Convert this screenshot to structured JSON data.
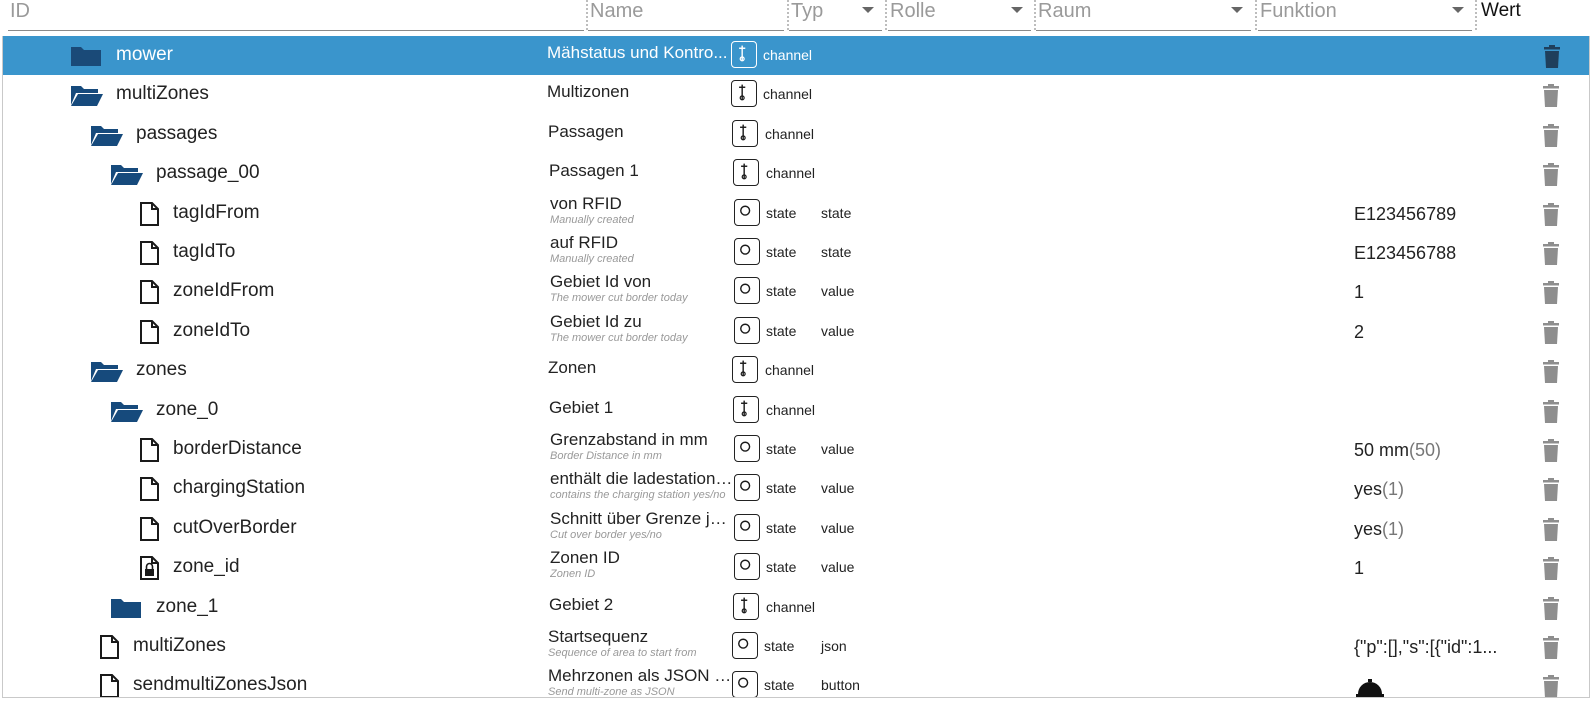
{
  "header": {
    "id_placeholder": "ID",
    "name_placeholder": "Name",
    "type_label": "Typ",
    "role_label": "Rolle",
    "room_label": "Raum",
    "function_label": "Funktion",
    "value_label": "Wert"
  },
  "rows": [
    {
      "id": "mower",
      "name": "Mähstatus und Kontro...",
      "desc": "",
      "type": "channel",
      "role": "",
      "value": "",
      "value_num": "",
      "icon": "folder-closed-icon",
      "selected": true
    },
    {
      "id": "multiZones",
      "name": "Multizonen",
      "desc": "",
      "type": "channel",
      "role": "",
      "value": "",
      "value_num": "",
      "icon": "folder-open-icon"
    },
    {
      "id": "passages",
      "name": "Passagen",
      "desc": "",
      "type": "channel",
      "role": "",
      "value": "",
      "value_num": "",
      "icon": "folder-open-icon"
    },
    {
      "id": "passage_00",
      "name": "Passagen 1",
      "desc": "",
      "type": "channel",
      "role": "",
      "value": "",
      "value_num": "",
      "icon": "folder-open-icon"
    },
    {
      "id": "tagIdFrom",
      "name": "von RFID",
      "desc": "Manually created",
      "type": "state",
      "role": "state",
      "value": "E123456789",
      "value_num": "",
      "icon": "file-icon"
    },
    {
      "id": "tagIdTo",
      "name": "auf RFID",
      "desc": "Manually created",
      "type": "state",
      "role": "state",
      "value": "E123456788",
      "value_num": "",
      "icon": "file-icon"
    },
    {
      "id": "zoneIdFrom",
      "name": "Gebiet Id von",
      "desc": "The mower cut border today",
      "type": "state",
      "role": "value",
      "value": "1",
      "value_num": "",
      "icon": "file-icon"
    },
    {
      "id": "zoneIdTo",
      "name": "Gebiet Id zu",
      "desc": "The mower cut border today",
      "type": "state",
      "role": "value",
      "value": "2",
      "value_num": "",
      "icon": "file-icon"
    },
    {
      "id": "zones",
      "name": "Zonen",
      "desc": "",
      "type": "channel",
      "role": "",
      "value": "",
      "value_num": "",
      "icon": "folder-open-icon"
    },
    {
      "id": "zone_0",
      "name": "Gebiet 1",
      "desc": "",
      "type": "channel",
      "role": "",
      "value": "",
      "value_num": "",
      "icon": "folder-open-icon"
    },
    {
      "id": "borderDistance",
      "name": "Grenzabstand in mm",
      "desc": "Border Distance in mm",
      "type": "state",
      "role": "value",
      "value": "50 mm",
      "value_num": "(50)",
      "icon": "file-icon"
    },
    {
      "id": "chargingStation",
      "name": "enthält die ladestation ja/nein",
      "desc": "contains the charging station yes/no",
      "type": "state",
      "role": "value",
      "value": "yes",
      "value_num": "(1)",
      "icon": "file-icon"
    },
    {
      "id": "cutOverBorder",
      "name": "Schnitt über Grenze ja/nein",
      "desc": "Cut over border yes/no",
      "type": "state",
      "role": "value",
      "value": "yes",
      "value_num": "(1)",
      "icon": "file-icon"
    },
    {
      "id": "zone_id",
      "name": "Zonen ID",
      "desc": "Zonen ID",
      "type": "state",
      "role": "value",
      "value": "1",
      "value_num": "",
      "icon": "file-lock-icon"
    },
    {
      "id": "zone_1",
      "name": "Gebiet 2",
      "desc": "",
      "type": "channel",
      "role": "",
      "value": "",
      "value_num": "",
      "icon": "folder-closed-icon"
    },
    {
      "id": "multiZones",
      "name": "Startsequenz",
      "desc": "Sequence of area to start from",
      "type": "state",
      "role": "json",
      "value": "{\"p\":[],\"s\":[{\"id\":1...",
      "value_num": "",
      "icon": "file-icon"
    },
    {
      "id": "sendmultiZonesJson",
      "name": "Mehrzonen als JSON senden",
      "desc": "Send multi-zone as JSON",
      "type": "state",
      "role": "button",
      "value": "",
      "value_num": "",
      "icon": "file-icon",
      "value_icon": "bell-icon"
    }
  ],
  "colors": {
    "selected_row": "#3a95cc",
    "folder": "#164a7c",
    "trash": "#8e8e8e"
  }
}
